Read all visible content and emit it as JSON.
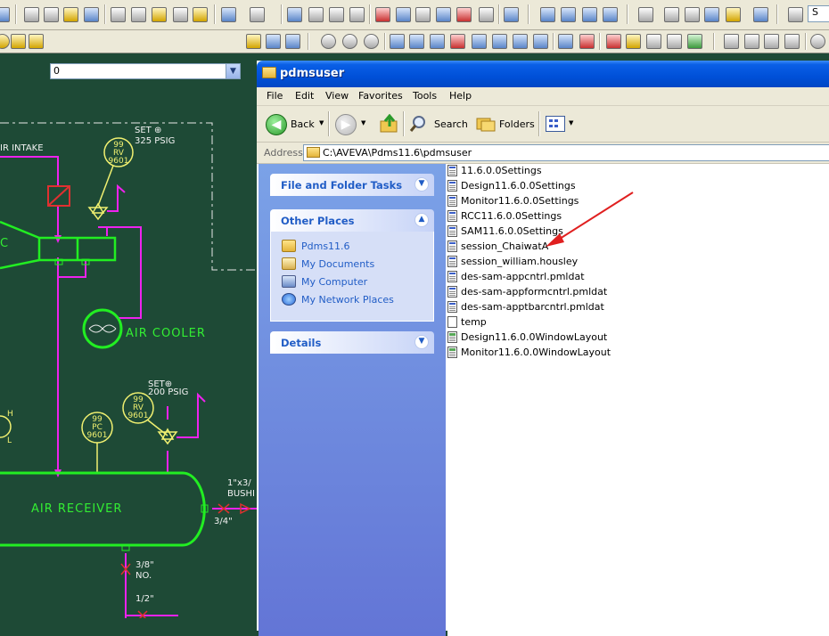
{
  "cad": {
    "layer_value": "0",
    "style_value": "S"
  },
  "drawing": {
    "labels": {
      "air_intake": "IR INTAKE",
      "set_325": "SET ⊕",
      "psig_325": "325 PSIG",
      "rv_top": [
        "99",
        "RV",
        "9601"
      ],
      "c_letter": "C",
      "air_cooler": "AIR COOLER",
      "set_200": "SET⊕",
      "psig_200": "200 PSIG",
      "pc": [
        "99",
        "PC",
        "9601"
      ],
      "rv_bottom": [
        "99",
        "RV",
        "9601"
      ],
      "h_letter": "H",
      "l_letter": "L",
      "air_receiver": "AIR RECEIVER",
      "bushing_size": "1\"x3/",
      "bushing": "BUSHI",
      "size_34": "3/4\"",
      "size_38": "3/8\"",
      "no": "NO.",
      "size_12": "1/2\""
    }
  },
  "explorer": {
    "title": "pdmsuser",
    "menu": [
      "File",
      "Edit",
      "View",
      "Favorites",
      "Tools",
      "Help"
    ],
    "toolbar": {
      "back": "Back",
      "search": "Search",
      "folders": "Folders"
    },
    "address": {
      "label": "Address",
      "path": "C:\\AVEVA\\Pdms11.6\\pdmsuser"
    },
    "taskpane": {
      "file_folder_tasks": "File and Folder Tasks",
      "other_places": "Other Places",
      "places": [
        "Pdms11.6",
        "My Documents",
        "My Computer",
        "My Network Places"
      ],
      "details": "Details"
    },
    "files": [
      "11.6.0.0Settings",
      "Design11.6.0.0Settings",
      "Monitor11.6.0.0Settings",
      "RCC11.6.0.0Settings",
      "SAM11.6.0.0Settings",
      "session_ChaiwatA",
      "session_william.housley",
      "des-sam-appcntrl.pmldat",
      "des-sam-appformcntrl.pmldat",
      "des-sam-apptbarcntrl.pmldat",
      "temp",
      "Design11.6.0.0WindowLayout",
      "Monitor11.6.0.0WindowLayout"
    ]
  },
  "colors": {
    "drawing_bg": "#1e4a36",
    "magenta_line": "#ee22ee",
    "green_symbol": "#22ee22",
    "yellow_symbol": "#f0f070",
    "xp_title": "#0050d8",
    "taskpane": "#7ba2e7",
    "annotation_arrow": "#e02020"
  },
  "icons": {
    "back": "back-arrow-icon",
    "forward": "forward-arrow-icon",
    "up": "folder-up-icon",
    "search": "search-icon",
    "folders": "folders-icon",
    "views": "views-icon"
  }
}
